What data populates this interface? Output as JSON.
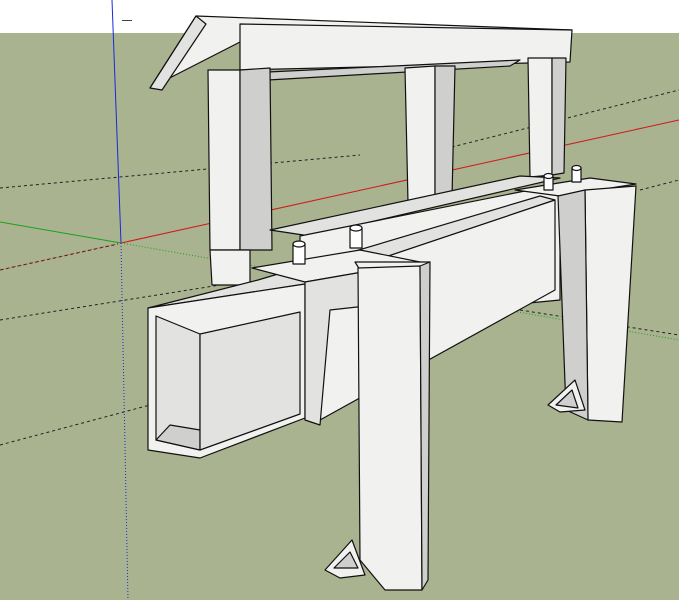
{
  "colors": {
    "sky": "#ffffff",
    "ground": "#a9b390",
    "face_light": "#f1f1ef",
    "face_mid": "#e2e2e0",
    "face_dark": "#cfcfcd",
    "edge": "#111111",
    "axis_red": "#d01818",
    "axis_green": "#1aa21a",
    "axis_blue": "#1a2ad8",
    "guide": "#222222"
  },
  "icons": {
    "origin_marker": "short-dash-icon"
  }
}
